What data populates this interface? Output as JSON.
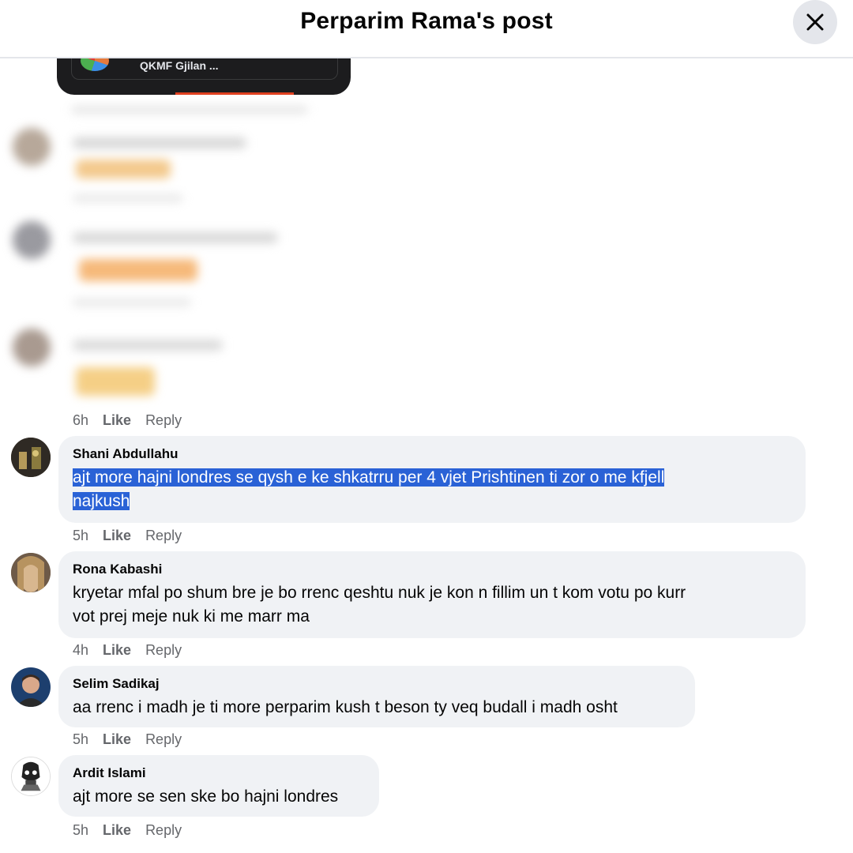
{
  "header": {
    "title": "Perparim Rama's post",
    "close_icon": "close-icon"
  },
  "preview": {
    "label": "QKMF Gjilan ..."
  },
  "blurred_meta": {
    "time": "6h",
    "like": "Like",
    "reply": "Reply"
  },
  "comments": [
    {
      "name": "Shani Abdullahu",
      "line1": "ajt more hajni londres se qysh e ke shkatrru per 4 vjet Prishtinen ti zor o me kfjell",
      "line2": "najkush",
      "time": "5h",
      "like": "Like",
      "reply": "Reply",
      "selected": true
    },
    {
      "name": "Rona Kabashi",
      "line1": "kryetar mfal po shum bre je bo rrenc qeshtu nuk je kon n fillim un t kom votu po kurr",
      "line2": "vot prej meje nuk ki me marr ma",
      "time": "4h",
      "like": "Like",
      "reply": "Reply"
    },
    {
      "name": "Selim Sadikaj",
      "line1": "aa rrenc i madh je ti more perparim kush t beson ty veq budall i madh osht",
      "time": "5h",
      "like": "Like",
      "reply": "Reply"
    },
    {
      "name": "Ardit Islami",
      "line1": "ajt more se sen ske bo hajni londres",
      "time": "5h",
      "like": "Like",
      "reply": "Reply"
    }
  ],
  "colors": {
    "bubble": "#f0f2f5",
    "selection": "#2a62d6",
    "meta_text": "#65676b"
  }
}
